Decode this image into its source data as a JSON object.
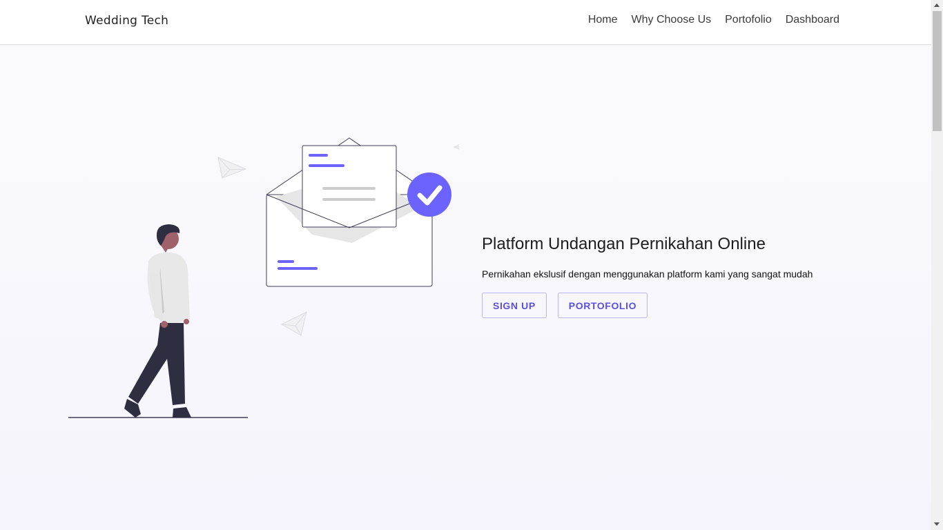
{
  "navbar": {
    "brand": "Wedding Tech",
    "links": [
      "Home",
      "Why Choose Us",
      "Portofolio",
      "Dashboard"
    ]
  },
  "hero": {
    "title": "Platform Undangan Pernikahan Online",
    "subtitle": "Pernikahan ekslusif dengan menggunakan platform kami yang sangat mudah",
    "buttons": [
      "SIGN UP",
      "PORTOFOLIO"
    ]
  },
  "colors": {
    "accent": "#6c63ff",
    "button_text": "#5b50e0",
    "background": "#f7f6fd",
    "navbar": "#ffffff"
  },
  "icons": {
    "illustration": "man-walking-envelope-illustration",
    "badge": "check-icon",
    "planes": "paper-plane-icon"
  }
}
